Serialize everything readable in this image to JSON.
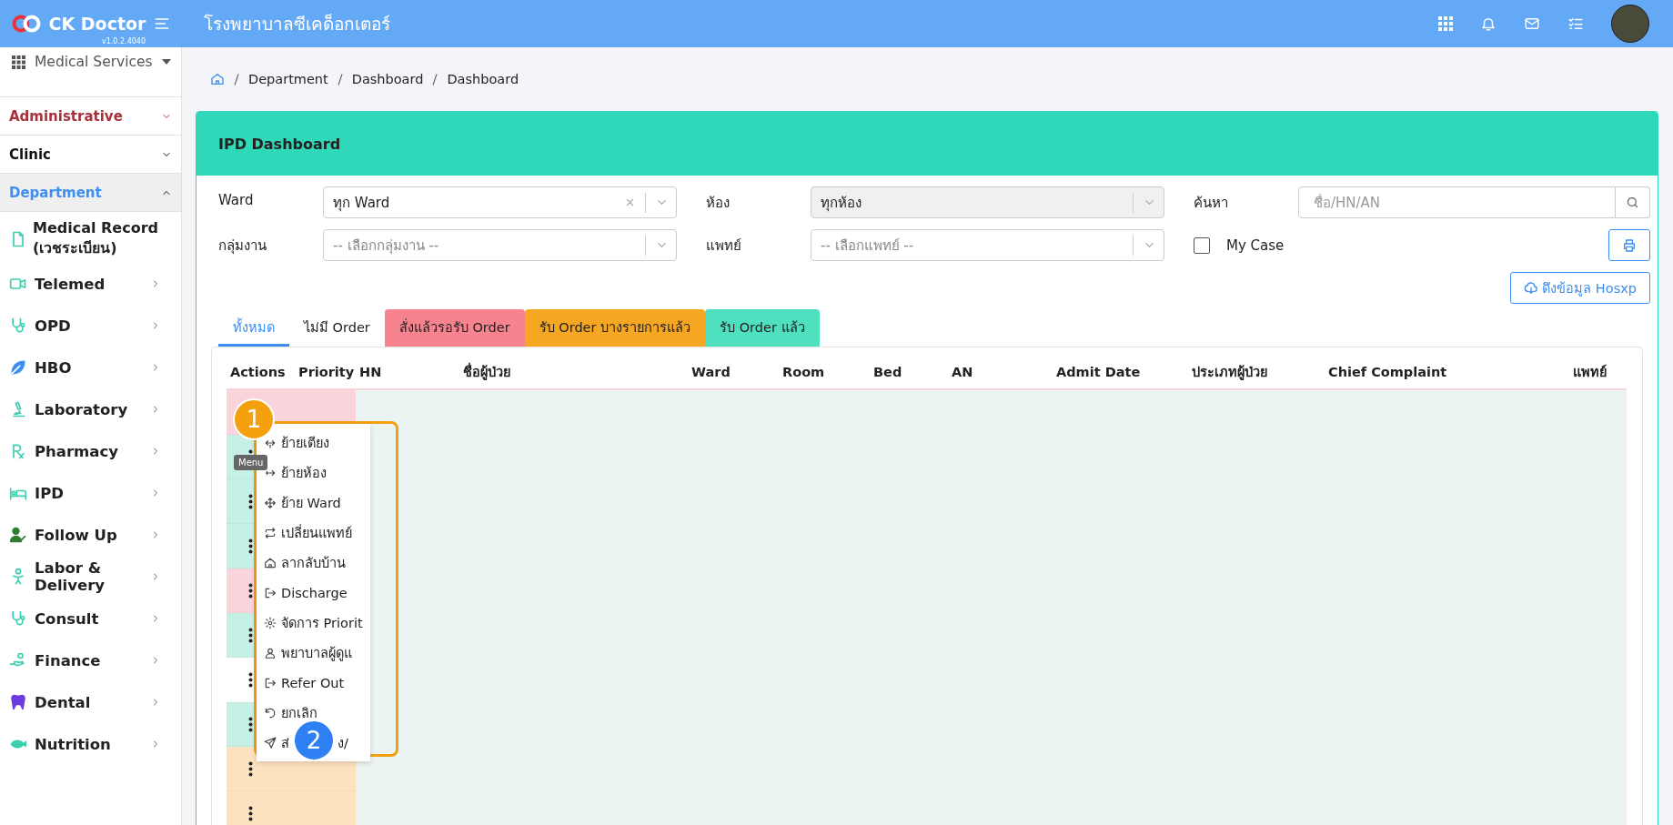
{
  "header": {
    "brand": "CK Doctor",
    "version": "v1.0.2.4040",
    "title": "โรงพยาบาลซีเคด็อกเตอร์"
  },
  "sidebar": {
    "switcher": "Medical Services",
    "groups": [
      {
        "label": "Administrative",
        "kind": "danger",
        "expanded": false
      },
      {
        "label": "Clinic",
        "kind": "plain",
        "expanded": false
      },
      {
        "label": "Department",
        "kind": "primary",
        "expanded": true
      }
    ],
    "items": [
      {
        "label": "Medical Record (เวชระเบียน)",
        "expandable": false
      },
      {
        "label": "Telemed",
        "expandable": true
      },
      {
        "label": "OPD",
        "expandable": true
      },
      {
        "label": "HBO",
        "expandable": true
      },
      {
        "label": "Laboratory",
        "expandable": true
      },
      {
        "label": "Pharmacy",
        "expandable": true
      },
      {
        "label": "IPD",
        "expandable": true
      },
      {
        "label": "Follow Up",
        "expandable": true
      },
      {
        "label": "Labor & Delivery",
        "expandable": true
      },
      {
        "label": "Consult",
        "expandable": true
      },
      {
        "label": "Finance",
        "expandable": true
      },
      {
        "label": "Dental",
        "expandable": true
      },
      {
        "label": "Nutrition",
        "expandable": true
      }
    ]
  },
  "breadcrumb": [
    "Department",
    "Dashboard",
    "Dashboard"
  ],
  "card": {
    "title": "IPD Dashboard",
    "filters": {
      "ward": {
        "label": "Ward",
        "value": "ทุก Ward",
        "clearable": true
      },
      "room": {
        "label": "ห้อง",
        "value": "ทุกห้อง",
        "disabled": true
      },
      "search": {
        "label": "ค้นหา",
        "placeholder": "ชื่อ/HN/AN"
      },
      "group": {
        "label": "กลุ่มงาน",
        "placeholder": "-- เลือกกลุ่มงาน --"
      },
      "doctor": {
        "label": "แพทย์",
        "placeholder": "-- เลือกแพทย์ --"
      },
      "my_case": {
        "label": "My Case",
        "checked": false
      }
    },
    "hosxp_button": "ดึงข้อมูล Hosxp",
    "tabs": [
      {
        "label": "ทั้งหมด",
        "selected": true
      },
      {
        "label": "ไม่มี Order",
        "selected": false
      },
      {
        "label": "สั่งแล้วรอรับ Order",
        "selected": false,
        "color": "#f7838f"
      },
      {
        "label": "รับ Order บางรายการแล้ว",
        "selected": false,
        "color": "#f5a623"
      },
      {
        "label": "รับ Order แล้ว",
        "selected": false,
        "color": "#4fe0c0"
      }
    ],
    "table": {
      "columns": [
        "Actions",
        "Priority",
        "HN",
        "ชื่อผู้ป่วย",
        "Ward",
        "Room",
        "Bed",
        "AN",
        "Admit Date",
        "ประเภทผู้ป่วย",
        "Chief Complaint",
        "แพทย์"
      ],
      "rows": [
        {
          "color": "#fbd3da"
        },
        {
          "color": "#c6f0e5"
        },
        {
          "color": "#c6f0e5"
        },
        {
          "color": "#c6f0e5"
        },
        {
          "color": "#fbd3da"
        },
        {
          "color": "#c6f0e5"
        },
        {
          "color": "#ffffff"
        },
        {
          "color": "#c6f0e5"
        },
        {
          "color": "#fde2c0"
        },
        {
          "color": "#fde2c0"
        }
      ]
    }
  },
  "action_menu": {
    "tooltip": "Menu",
    "items": [
      {
        "label": "ย้ายเตียง"
      },
      {
        "label": "ย้ายห้อง"
      },
      {
        "label": "ย้าย Ward"
      },
      {
        "label": "เปลี่ยนแพทย์"
      },
      {
        "label": "ลากลับบ้าน"
      },
      {
        "label": "Discharge"
      },
      {
        "label": "จัดการ Priorit"
      },
      {
        "label": "พยาบาลผู้ดูแ"
      },
      {
        "label": "Refer Out"
      },
      {
        "label": "ยกเลิก"
      },
      {
        "label": "ส่",
        "label_after_badge": "ง/"
      }
    ]
  },
  "annotations": [
    {
      "label": "1",
      "color": "#f5a00f"
    },
    {
      "label": "2",
      "color": "#2f80f2"
    }
  ]
}
